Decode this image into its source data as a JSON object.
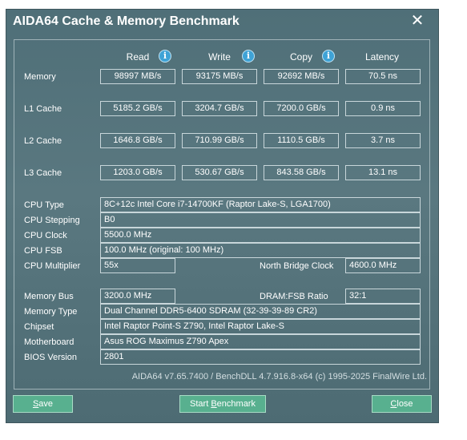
{
  "window": {
    "title": "AIDA64 Cache & Memory Benchmark",
    "close_glyph": "✕"
  },
  "columns": {
    "read": "Read",
    "write": "Write",
    "copy": "Copy",
    "latency": "Latency",
    "info_glyph": "i"
  },
  "rows": [
    {
      "label": "Memory",
      "read": "98997 MB/s",
      "write": "93175 MB/s",
      "copy": "92692 MB/s",
      "latency": "70.5 ns"
    },
    {
      "label": "L1 Cache",
      "read": "5185.2 GB/s",
      "write": "3204.7 GB/s",
      "copy": "7200.0 GB/s",
      "latency": "0.9 ns"
    },
    {
      "label": "L2 Cache",
      "read": "1646.8 GB/s",
      "write": "710.99 GB/s",
      "copy": "1110.5 GB/s",
      "latency": "3.7 ns"
    },
    {
      "label": "L3 Cache",
      "read": "1203.0 GB/s",
      "write": "530.67 GB/s",
      "copy": "843.58 GB/s",
      "latency": "13.1 ns"
    }
  ],
  "cpu": {
    "type_label": "CPU Type",
    "type": "8C+12c Intel Core i7-14700KF  (Raptor Lake-S, LGA1700)",
    "stepping_label": "CPU Stepping",
    "stepping": "B0",
    "clock_label": "CPU Clock",
    "clock": "5500.0 MHz",
    "fsb_label": "CPU FSB",
    "fsb": "100.0 MHz  (original: 100 MHz)",
    "multiplier_label": "CPU Multiplier",
    "multiplier": "55x",
    "nb_clock_label": "North Bridge Clock",
    "nb_clock": "4600.0 MHz"
  },
  "system": {
    "membus_label": "Memory Bus",
    "membus": "3200.0 MHz",
    "ratio_label": "DRAM:FSB Ratio",
    "ratio": "32:1",
    "memtype_label": "Memory Type",
    "memtype": "Dual Channel DDR5-6400 SDRAM  (32-39-39-89 CR2)",
    "chipset_label": "Chipset",
    "chipset": "Intel Raptor Point-S Z790, Intel Raptor Lake-S",
    "mobo_label": "Motherboard",
    "mobo": "Asus ROG Maximus Z790 Apex",
    "bios_label": "BIOS Version",
    "bios": "2801"
  },
  "footer": "AIDA64 v7.65.7400 / BenchDLL 4.7.916.8-x64  (c) 1995-2025 FinalWire Ltd.",
  "buttons": {
    "save_pre": "",
    "save_key": "S",
    "save_post": "ave",
    "start_pre": "Start ",
    "start_key": "B",
    "start_post": "enchmark",
    "close_pre": "",
    "close_key": "C",
    "close_post": "lose"
  },
  "colors": {
    "window_bg": "#56737b",
    "button_bg": "#58b08f",
    "info_icon": "#3fa3d6"
  }
}
